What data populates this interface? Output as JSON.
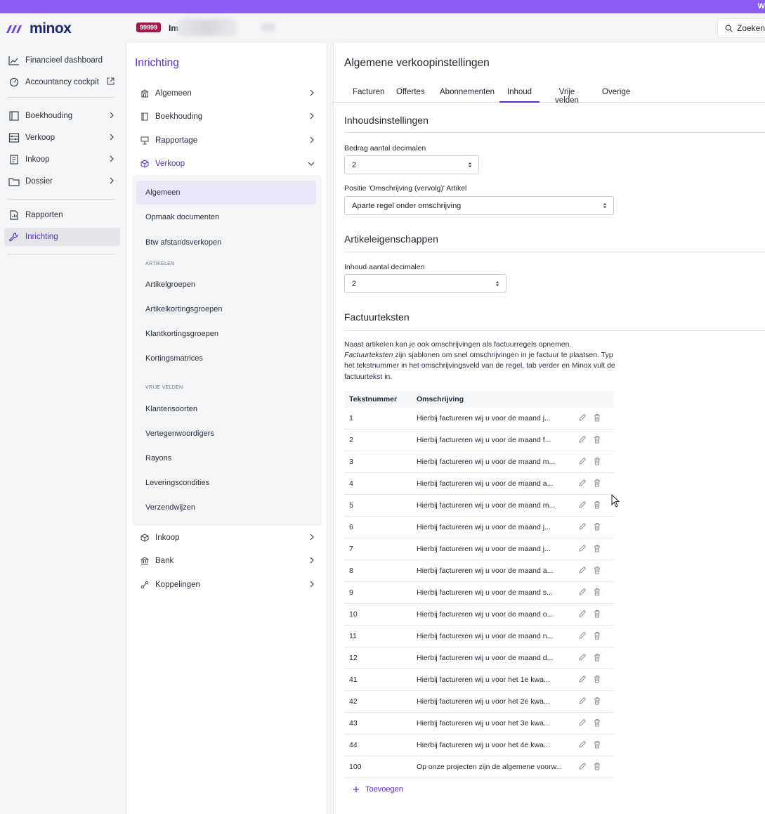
{
  "topbar": {
    "text": "W"
  },
  "brand": {
    "name": "minox",
    "accent": "#5b2dc9",
    "banner": "#8b5cf6"
  },
  "header": {
    "admin_badge": "99999",
    "admin_name": "Im",
    "search_label": "Zoeken"
  },
  "sidebar": {
    "items": [
      {
        "label": "Financieel dashboard",
        "icon": "chart-icon"
      },
      {
        "label": "Accountancy cockpit",
        "icon": "gauge-icon",
        "external": true
      },
      {
        "label": "Boekhouding",
        "icon": "ledger-icon",
        "chevron": true
      },
      {
        "label": "Verkoop",
        "icon": "abacus-icon",
        "chevron": true
      },
      {
        "label": "Inkoop",
        "icon": "receipt-icon",
        "chevron": true
      },
      {
        "label": "Dossier",
        "icon": "folder-icon",
        "chevron": true
      },
      {
        "label": "Rapporten",
        "icon": "report-icon"
      },
      {
        "label": "Inrichting",
        "icon": "wrench-icon",
        "active": true
      }
    ]
  },
  "submenu": {
    "title": "Inrichting",
    "items": [
      {
        "label": "Algemeen"
      },
      {
        "label": "Boekhouding"
      },
      {
        "label": "Rapportage"
      },
      {
        "label": "Verkoop"
      }
    ],
    "verkoop_children": {
      "top": [
        "Algemeen",
        "Opmaak documenten",
        "Btw afstandsverkopen"
      ],
      "section_artikelen": "ARTIKELEN",
      "artikelen": [
        "Artikelgroepen",
        "Artikelkortingsgroepen",
        "Klantkortingsgroepen",
        "Kortingsmatrices"
      ],
      "section_vrije": "VRIJE VELDEN",
      "vrije": [
        "Klantensoorten",
        "Vertegenwoordigers",
        "Rayons",
        "Leveringscondities",
        "Verzendwijzen"
      ]
    },
    "bottom_items": [
      {
        "label": "Inkoop"
      },
      {
        "label": "Bank"
      },
      {
        "label": "Koppelingen"
      }
    ]
  },
  "content": {
    "title": "Algemene verkoopinstellingen",
    "tabs": [
      "Facturen",
      "Offertes",
      "Abonnementen",
      "Inhoud",
      "Vrije velden",
      "Overige"
    ],
    "active_tab": "Inhoud",
    "inhoud": {
      "title": "Inhoudsinstellingen",
      "bedrag_label": "Bedrag aantal decimalen",
      "bedrag_value": "2",
      "positie_label": "Positie 'Omschrijving (vervolg)' Artikel",
      "positie_value": "Aparte regel onder omschrijving"
    },
    "artikel": {
      "title": "Artikeleigenschappen",
      "inhoud_label": "Inhoud aantal decimalen",
      "inhoud_value": "2"
    },
    "factuur": {
      "title": "Factuurteksten",
      "intro_1": "Naast artikelen kan je ook omschrijvingen als factuurregels opnemen.",
      "intro_em": "Factuurteksten",
      "intro_2": " zijn sjablonen om snel omschrijvingen in je factuur te plaatsen. Typ het tekstnummer in het omschrijvingsveld van de regel, tab verder en Minox vult de factuurtekst in.",
      "col_num": "Tekstnummer",
      "col_desc": "Omschrijving",
      "rows": [
        {
          "num": "1",
          "desc": "Hierbij factureren wij u voor de maand j..."
        },
        {
          "num": "2",
          "desc": "Hierbij factureren wij u voor de maand f..."
        },
        {
          "num": "3",
          "desc": "Hierbij factureren wij u voor de maand m..."
        },
        {
          "num": "4",
          "desc": "Hierbij factureren wij u voor de maand a..."
        },
        {
          "num": "5",
          "desc": "Hierbij factureren wij u voor de maand m..."
        },
        {
          "num": "6",
          "desc": "Hierbij factureren wij u voor de maand j..."
        },
        {
          "num": "7",
          "desc": "Hierbij factureren wij u voor de maand j..."
        },
        {
          "num": "8",
          "desc": "Hierbij factureren wij u voor de maand a..."
        },
        {
          "num": "9",
          "desc": "Hierbij factureren wij u voor de maand s..."
        },
        {
          "num": "10",
          "desc": "Hierbij factureren wij u voor de maand o..."
        },
        {
          "num": "11",
          "desc": "Hierbij factureren wij u voor de maand n..."
        },
        {
          "num": "12",
          "desc": "Hierbij factureren wij u voor de maand d..."
        },
        {
          "num": "41",
          "desc": "Hierbij factureren wij u voor het 1e kwa..."
        },
        {
          "num": "42",
          "desc": "Hierbij factureren wij u voor het 2e kwa..."
        },
        {
          "num": "43",
          "desc": "Hierbij factureren wij u voor het 3e kwa..."
        },
        {
          "num": "44",
          "desc": "Hierbij factureren wij u voor het 4e kwa..."
        },
        {
          "num": "100",
          "desc": "Op onze projecten zijn de algemene voorw..."
        }
      ],
      "add_label": "Toevoegen"
    }
  }
}
